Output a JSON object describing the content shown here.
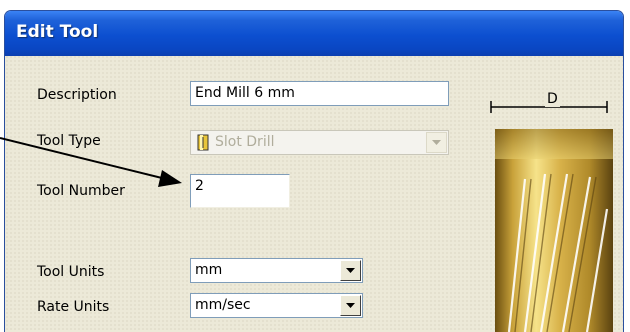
{
  "dialog": {
    "title": "Edit Tool"
  },
  "fields": {
    "description": {
      "label": "Description",
      "value": "End Mill 6 mm"
    },
    "tool_type": {
      "label": "Tool Type",
      "value": "Slot Drill"
    },
    "tool_number": {
      "label": "Tool Number",
      "value": "2"
    },
    "tool_units": {
      "label": "Tool Units",
      "value": "mm"
    },
    "rate_units": {
      "label": "Rate Units",
      "value": "mm/sec"
    }
  },
  "diagram": {
    "dimension_label": "D"
  },
  "colors": {
    "titlebar": "#0c4fd0",
    "dialog_bg": "#ece9d8",
    "field_border": "#7f9db9",
    "tool_gold": "#c9a23a"
  },
  "icons": {
    "tool_type": "slot-drill-icon",
    "dropdown": "dropdown-arrow-icon"
  }
}
